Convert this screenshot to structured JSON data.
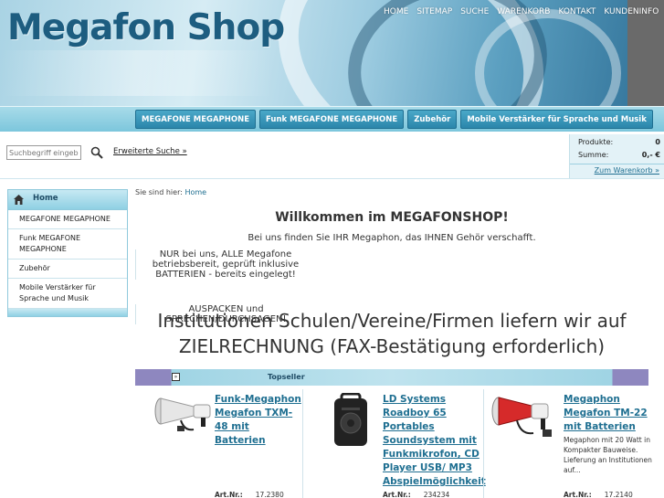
{
  "header": {
    "logo": "Megafon Shop",
    "topnav": [
      "HOME",
      "SITEMAP",
      "SUCHE",
      "WARENKORB",
      "KONTAKT",
      "KUNDENINFO"
    ]
  },
  "categories": [
    "MEGAFONE MEGAPHONE",
    "Funk MEGAFONE MEGAPHONE",
    "Zubehör",
    "Mobile Verstärker für Sprache und Musik"
  ],
  "search": {
    "placeholder": "Suchbegriff eingeben",
    "advanced_label": "Erweiterte Suche »"
  },
  "cart": {
    "products_label": "Produkte:",
    "products_value": "0",
    "sum_label": "Summe:",
    "sum_value": "0,- €",
    "link_label": "Zum Warenkorb »"
  },
  "sidebar": {
    "home_label": "Home",
    "items": [
      {
        "label": "MEGAFONE MEGAPHONE"
      },
      {
        "label": "Funk MEGAFONE MEGAPHONE"
      },
      {
        "label": "Zubehör"
      },
      {
        "label": "Mobile Verstärker für Sprache und Musik"
      }
    ]
  },
  "breadcrumb": {
    "prefix": "Sie sind hier:",
    "link": "Home"
  },
  "welcome": {
    "title": "Willkommen im MEGAFONSHOP!",
    "line1": "Bei uns finden Sie IHR Megaphon, das IHNEN Gehör verschafft.",
    "line2": "NUR bei uns, ALLE Megafone betriebsbereit, geprüft inklusive BATTERIEN - bereits eingelegt!",
    "line3": "AUSPACKEN und SPRECHEN/DURCHSAGEN!",
    "big": "Institutionen Schulen/Vereine/Firmen liefern wir auf ZIELRECHNUNG (FAX-Bestätigung erforderlich)"
  },
  "topseller": {
    "label": "Topseller",
    "icon": "»"
  },
  "products": [
    {
      "title": "Funk-Megaphon Megafon TXM-48 mit Batterien",
      "desc": "",
      "art_label": "Art.Nr.:",
      "art_no": "17.2380"
    },
    {
      "title": "LD Systems Roadboy 65 Portables Soundsystem mit Funkmikrofon, CD Player USB/ MP3 Abspielmöglichkeit",
      "desc": "",
      "art_label": "Art.Nr.:",
      "art_no": "234234"
    },
    {
      "title": "Megaphon Megafon TM-22 mit Batterien",
      "desc": "Megaphon mit 20 Watt in Kompakter Bauweise. Lieferung an Institutionen auf...",
      "art_label": "Art.Nr.:",
      "art_no": "17.2140"
    }
  ],
  "colors": {
    "accent": "#2b86ab",
    "link": "#1f6f91",
    "logo": "#1d5d80"
  }
}
